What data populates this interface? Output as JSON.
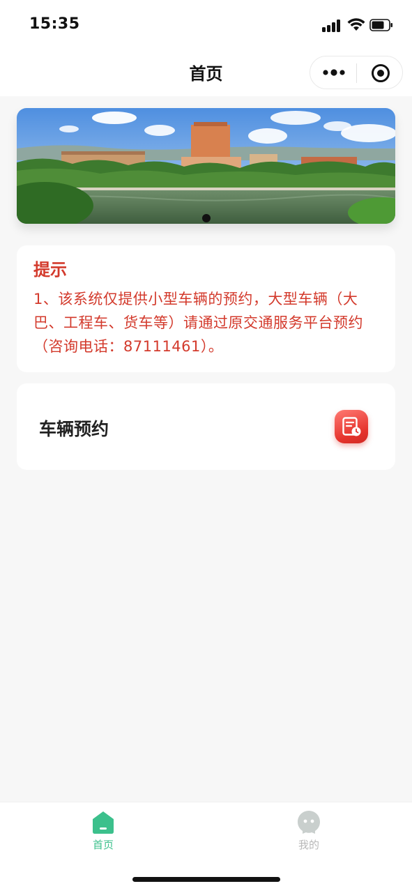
{
  "status_bar": {
    "time": "15:35",
    "icons": [
      "signal-icon",
      "wifi-icon",
      "battery-icon"
    ]
  },
  "nav_bar": {
    "title": "首页",
    "capsule_icons": [
      "more-icon",
      "close-miniprogram-icon"
    ]
  },
  "banner": {
    "image": "campus-panorama-image",
    "carousel_active_index": 1,
    "carousel_count": 1
  },
  "notice": {
    "title": "提示",
    "body": "1、该系统仅提供小型车辆的预约，大型车辆（大巴、工程车、货车等）请通过原交通服务平台预约（咨询电话：87111461）。"
  },
  "actions": [
    {
      "label": "车辆预约",
      "icon": "reservation-form-icon"
    }
  ],
  "tab_bar": {
    "items": [
      {
        "label": "首页",
        "icon": "home-icon",
        "active": true
      },
      {
        "label": "我的",
        "icon": "profile-icon",
        "active": false
      }
    ],
    "active_color": "#3cc08c",
    "inactive_color": "#b8b8b8"
  },
  "colors": {
    "notice_text": "#d33a2c",
    "action_icon": "#e5332c",
    "page_background": "#f7f7f7"
  }
}
